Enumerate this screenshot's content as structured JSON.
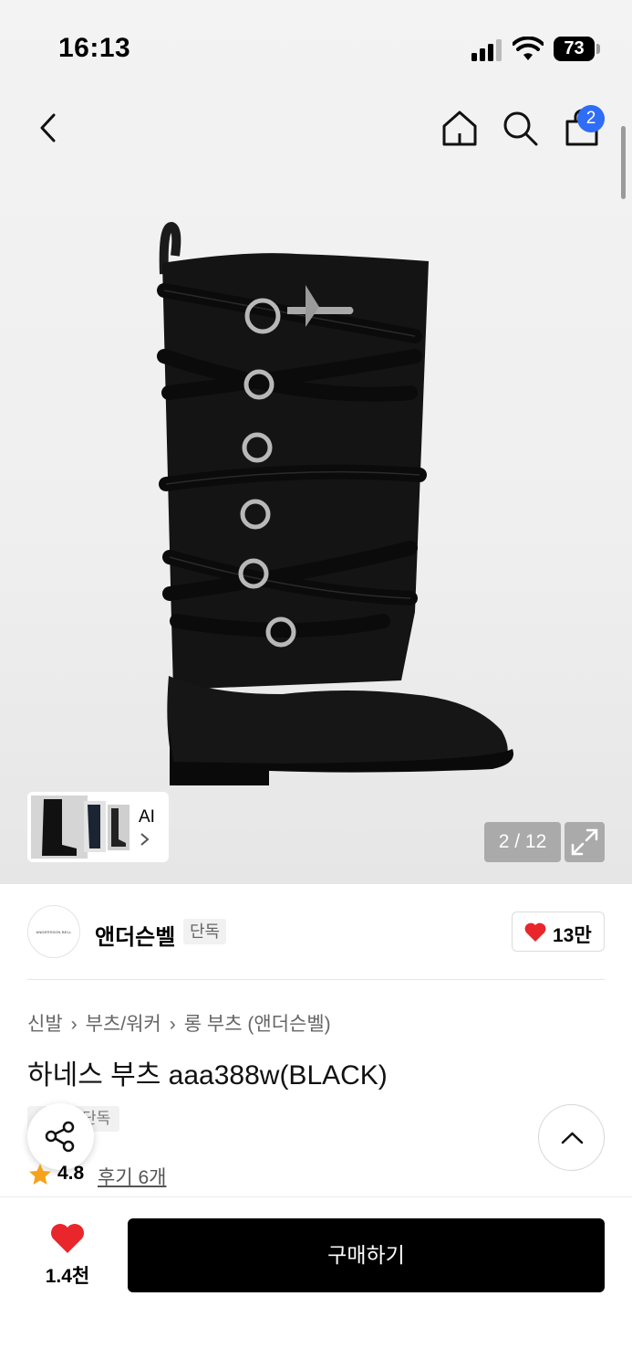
{
  "status_bar": {
    "time": "16:13",
    "battery": "73"
  },
  "header": {
    "cart_count": "2"
  },
  "gallery": {
    "thumb_label": "AI",
    "page_counter": "2 / 12"
  },
  "brand": {
    "logo_text": "ANDERSSON BELL",
    "name": "앤더슨벨",
    "exclusive_tag": "단독",
    "like_count": "13만"
  },
  "product": {
    "breadcrumb": [
      "신발",
      "부츠/워커",
      "롱 부츠 (앤더슨벨)"
    ],
    "title": "하네스 부츠 aaa388w(BLACK)",
    "tag": "단독",
    "rating": "4.8",
    "reviews": "후기 6개"
  },
  "bottom_bar": {
    "wish_count": "1.4천",
    "buy_label": "구매하기"
  },
  "colors": {
    "accent_blue": "#2f6df6",
    "heart_red": "#e8262c",
    "star_orange": "#f6a21a",
    "button_black": "#000000"
  },
  "icons": [
    "back-icon",
    "home-icon",
    "search-icon",
    "cart-icon",
    "expand-icon",
    "heart-icon",
    "share-icon",
    "chevron-up-icon",
    "star-icon"
  ]
}
